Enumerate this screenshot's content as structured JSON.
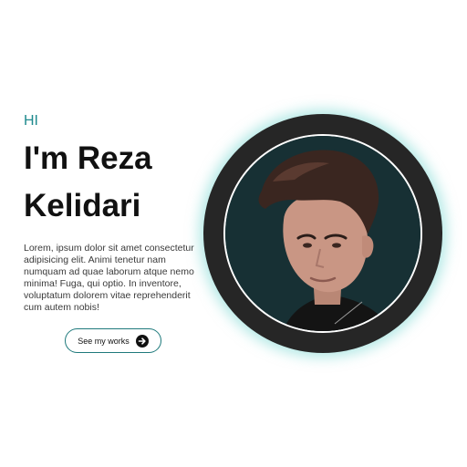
{
  "hero": {
    "greeting": "HI",
    "name_line_1": "I'm Reza",
    "name_line_2": "Kelidari",
    "bio": "Lorem, ipsum dolor sit amet consectetur adipisicing elit. Animi tenetur nam numquam ad quae laborum atque nemo minima! Fuga, qui optio. In inventore, voluptatum dolorem vitae reprehenderit cum autem nobis!",
    "cta_label": "See my works",
    "cta_icon": "arrow-right-circle-icon",
    "portrait_icon": "profile-photo"
  },
  "colors": {
    "accent": "#1f8a8e",
    "text": "#111111",
    "frame": "#262626",
    "photo_background": "#173034",
    "glow": "#78d7d2"
  }
}
